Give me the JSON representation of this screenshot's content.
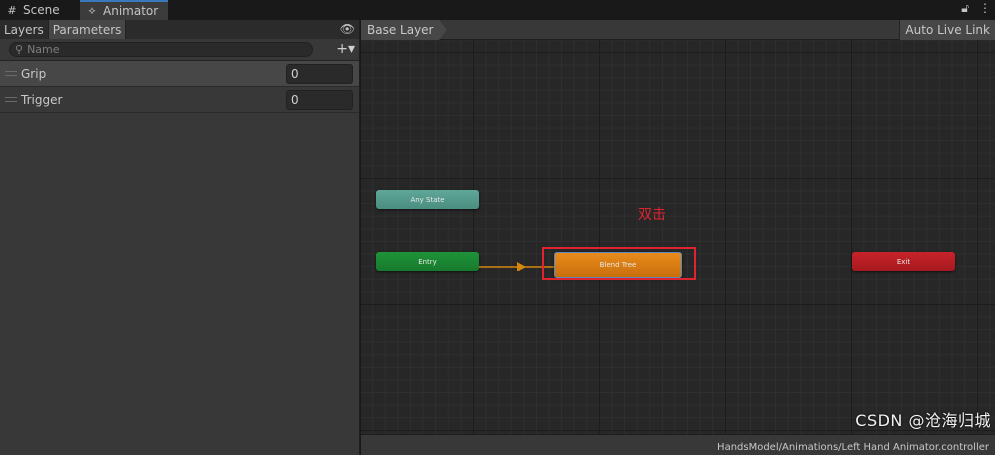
{
  "tabs": {
    "scene_label": "Scene",
    "animator_label": "Animator",
    "scene_icon": "grid-icon",
    "animator_icon": "animator-icon"
  },
  "window_icons": {
    "lock": "lock-icon",
    "menu": "kebab-menu-icon"
  },
  "left_panel": {
    "layers_tab": "Layers",
    "parameters_tab": "Parameters",
    "visibility_icon": "eye-icon",
    "search": {
      "placeholder": "Name",
      "value": ""
    },
    "add_icon": "plus-icon",
    "parameters": [
      {
        "name": "Grip",
        "value": "0"
      },
      {
        "name": "Trigger",
        "value": "0"
      }
    ]
  },
  "graph": {
    "breadcrumb": "Base Layer",
    "auto_live_link": "Auto Live Link",
    "nodes": {
      "any_state": "Any State",
      "entry": "Entry",
      "blend_tree": "Blend Tree",
      "exit": "Exit"
    },
    "annotation": "双击",
    "status_path": "HandsModel/Animations/Left Hand Animator.controller",
    "colors": {
      "any_state": "#5fa799",
      "entry": "#1f9339",
      "blend_tree": "#e88b1c",
      "exit": "#c8232a",
      "highlight": "#e0242f",
      "arrow": "#d4860e"
    }
  },
  "watermark": "CSDN @沧海归城"
}
